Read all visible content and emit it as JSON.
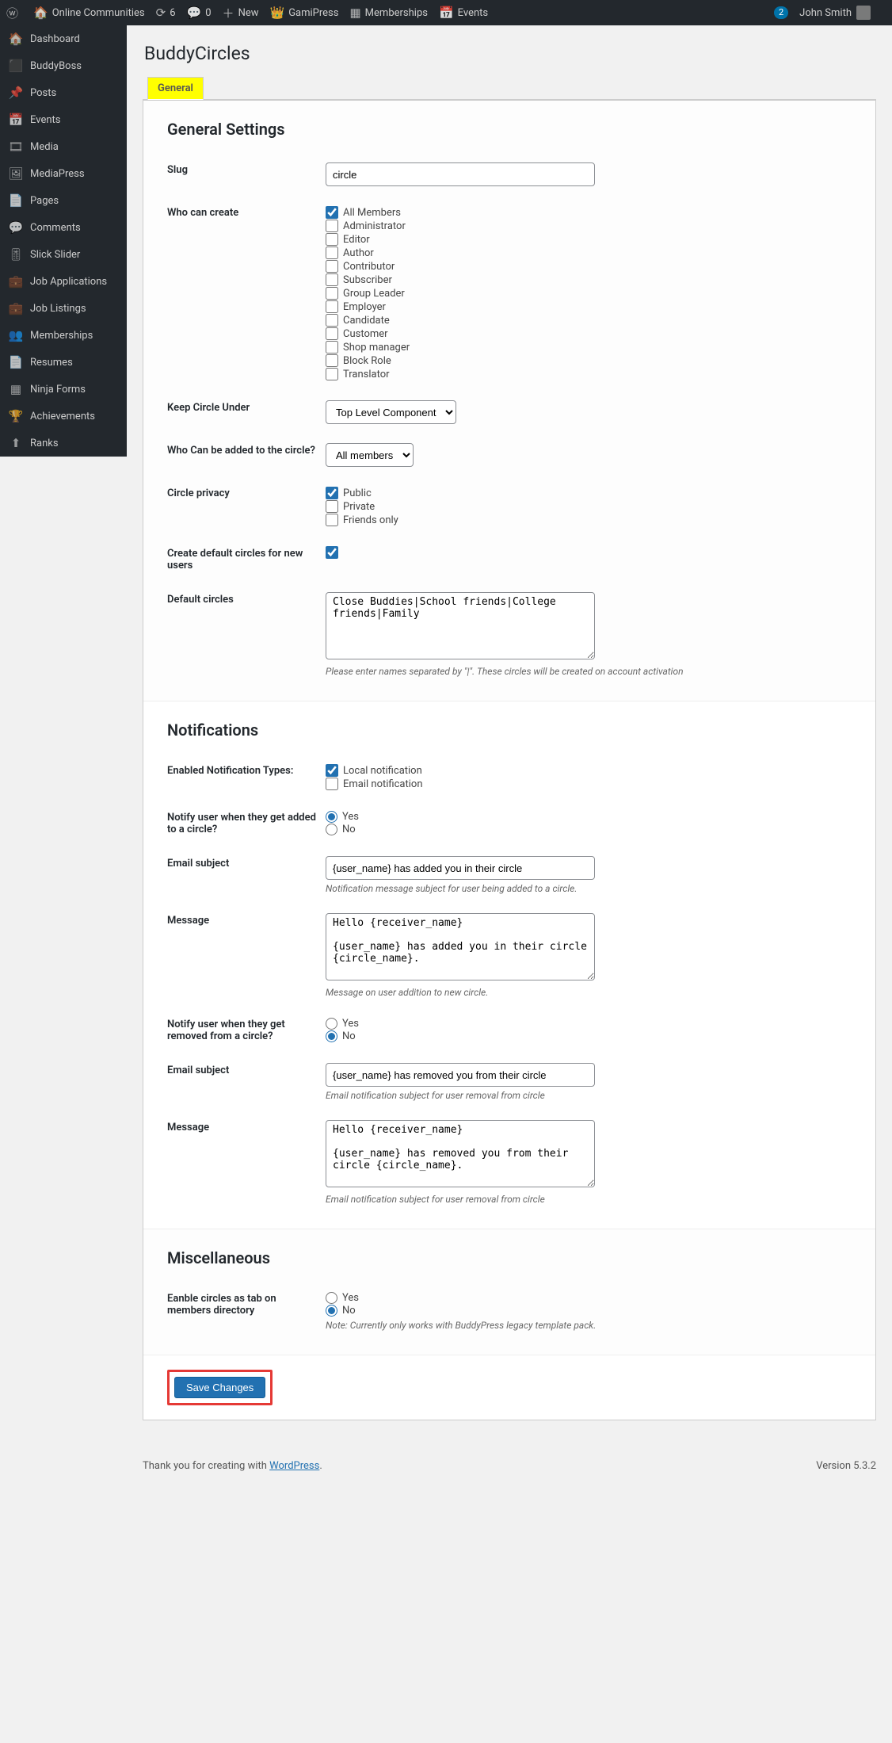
{
  "adminbar": {
    "site_name": "Online Communities",
    "updates": "6",
    "comments": "0",
    "new": "New",
    "gamipress": "GamiPress",
    "memberships": "Memberships",
    "events": "Events",
    "notif_count": "2",
    "user": "John Smith"
  },
  "sidebar": [
    {
      "icon": "🏠",
      "label": "Dashboard"
    },
    {
      "icon": "⬛",
      "label": "BuddyBoss"
    },
    {
      "icon": "📌",
      "label": "Posts"
    },
    {
      "icon": "📅",
      "label": "Events"
    },
    {
      "icon": "🎞",
      "label": "Media"
    },
    {
      "icon": "🖼",
      "label": "MediaPress"
    },
    {
      "icon": "📄",
      "label": "Pages"
    },
    {
      "icon": "💬",
      "label": "Comments"
    },
    {
      "icon": "🎚",
      "label": "Slick Slider"
    },
    {
      "icon": "💼",
      "label": "Job Applications"
    },
    {
      "icon": "💼",
      "label": "Job Listings"
    },
    {
      "icon": "👥",
      "label": "Memberships"
    },
    {
      "icon": "📄",
      "label": "Resumes"
    },
    {
      "icon": "▦",
      "label": "Ninja Forms"
    },
    {
      "icon": "🏆",
      "label": "Achievements"
    },
    {
      "icon": "⬆",
      "label": "Ranks"
    }
  ],
  "page": {
    "title": "BuddyCircles",
    "tab": "General"
  },
  "general": {
    "heading": "General Settings",
    "slug_label": "Slug",
    "slug_value": "circle",
    "who_create_label": "Who can create",
    "roles": [
      {
        "label": "All Members",
        "checked": true
      },
      {
        "label": "Administrator",
        "checked": false
      },
      {
        "label": "Editor",
        "checked": false
      },
      {
        "label": "Author",
        "checked": false
      },
      {
        "label": "Contributor",
        "checked": false
      },
      {
        "label": "Subscriber",
        "checked": false
      },
      {
        "label": "Group Leader",
        "checked": false
      },
      {
        "label": "Employer",
        "checked": false
      },
      {
        "label": "Candidate",
        "checked": false
      },
      {
        "label": "Customer",
        "checked": false
      },
      {
        "label": "Shop manager",
        "checked": false
      },
      {
        "label": "Block Role",
        "checked": false
      },
      {
        "label": "Translator",
        "checked": false
      }
    ],
    "keep_under_label": "Keep Circle Under",
    "keep_under_value": "Top Level Component",
    "who_added_label": "Who Can be added to the circle?",
    "who_added_value": "All members",
    "privacy_label": "Circle privacy",
    "privacy": [
      {
        "label": "Public",
        "checked": true
      },
      {
        "label": "Private",
        "checked": false
      },
      {
        "label": "Friends only",
        "checked": false
      }
    ],
    "create_default_label": "Create default circles for new users",
    "create_default_checked": true,
    "default_circles_label": "Default circles",
    "default_circles_value": "Close Buddies|School friends|College friends|Family",
    "default_circles_desc": "Please enter names separated by \"|\". These circles will be created on account activation"
  },
  "notifications": {
    "heading": "Notifications",
    "enabled_label": "Enabled Notification Types:",
    "types": [
      {
        "label": "Local notification",
        "checked": true
      },
      {
        "label": "Email notification",
        "checked": false
      }
    ],
    "notify_added_label": "Notify user when they get added to a circle?",
    "notify_added": "Yes",
    "yes": "Yes",
    "no": "No",
    "subject1_label": "Email subject",
    "subject1_value": "{user_name} has added you in their circle",
    "subject1_desc": "Notification message subject for user being added to a circle.",
    "message1_label": "Message",
    "message1_value": "Hello {receiver_name}\n\n{user_name} has added you in their circle {circle_name}.",
    "message1_desc": "Message on user addition to new circle.",
    "notify_removed_label": "Notify user when they get removed from a circle?",
    "notify_removed": "No",
    "subject2_label": "Email subject",
    "subject2_value": "{user_name} has removed you from their circle",
    "subject2_desc": "Email notification subject for user removal from circle",
    "message2_label": "Message",
    "message2_value": "Hello {receiver_name}\n\n{user_name} has removed you from their circle {circle_name}.",
    "message2_desc": "Email notification subject for user removal from circle"
  },
  "misc": {
    "heading": "Miscellaneous",
    "tab_label": "Eanble circles as tab on members directory",
    "tab_value": "No",
    "tab_note": "Note: Currently only works with BuddyPress legacy template pack."
  },
  "submit": "Save Changes",
  "footer": {
    "thanks": "Thank you for creating with ",
    "wp": "WordPress",
    "version": "Version 5.3.2"
  }
}
